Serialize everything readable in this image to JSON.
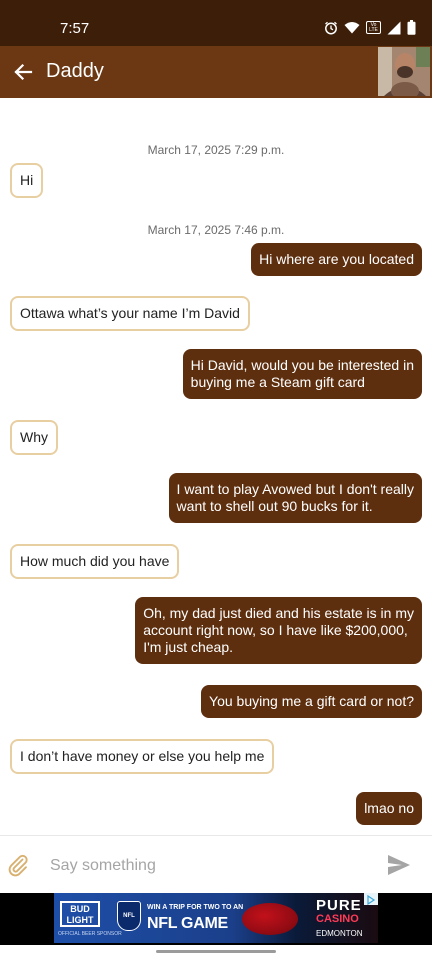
{
  "status_bar": {
    "time": "7:57",
    "icons": [
      "alarm-icon",
      "wifi-icon",
      "volte-icon",
      "signal-icon",
      "battery-icon"
    ],
    "volte_label": "Vo LTE"
  },
  "header": {
    "title": "Daddy",
    "back_icon": "arrow-left-icon",
    "avatar": "contact-photo"
  },
  "conversation": {
    "timestamps": [
      "March 17, 2025 7:29 p.m.",
      "March 17, 2025 7:46 p.m."
    ],
    "messages": [
      {
        "direction": "incoming",
        "lines": [
          "Hi"
        ]
      },
      {
        "direction": "outgoing",
        "lines": [
          "Hi where are you located"
        ]
      },
      {
        "direction": "incoming",
        "lines": [
          "Ottawa what’s your name I’m David"
        ]
      },
      {
        "direction": "outgoing",
        "lines": [
          "Hi David, would you be interested in",
          "buying me a Steam gift card"
        ]
      },
      {
        "direction": "incoming",
        "lines": [
          "Why"
        ]
      },
      {
        "direction": "outgoing",
        "lines": [
          "I want to play Avowed but I don't really",
          "want to shell out 90 bucks for it."
        ]
      },
      {
        "direction": "incoming",
        "lines": [
          "How much did you have"
        ]
      },
      {
        "direction": "outgoing",
        "lines": [
          "Oh, my dad just died and his estate is in my",
          "account right now, so I have like $200,000,",
          "I'm just cheap."
        ]
      },
      {
        "direction": "outgoing",
        "lines": [
          "You buying me a gift card or not?"
        ]
      },
      {
        "direction": "incoming",
        "lines": [
          "I don’t have money or else you help me"
        ]
      },
      {
        "direction": "outgoing",
        "lines": [
          "lmao no"
        ]
      }
    ]
  },
  "composer": {
    "placeholder": "Say something",
    "value": "",
    "attach_icon": "paperclip-icon",
    "send_icon": "send-icon"
  },
  "ad": {
    "logo_lines": [
      "BUD",
      "LIGHT"
    ],
    "sponsor": "OFFICIAL BEER SPONSOR",
    "shield": "NFL",
    "headline": "WIN A TRIP FOR TWO TO AN",
    "title": "NFL GAME",
    "brand": "PURE",
    "subbrand": "CASINO",
    "city": "EDMONTON"
  },
  "colors": {
    "status_bar": "#3d1e08",
    "app_bar": "#6b3813",
    "outgoing_bubble": "#5e2f0f",
    "incoming_border": "#e8cfa2",
    "attach_icon": "#d8b070",
    "send_icon": "#a5a5a5"
  }
}
